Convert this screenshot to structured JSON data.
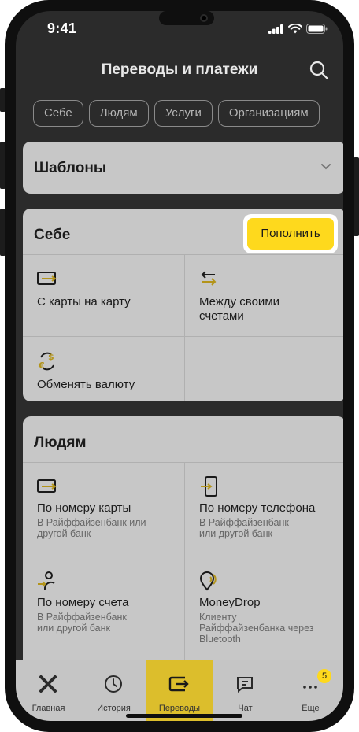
{
  "status": {
    "time": "9:41"
  },
  "header": {
    "title": "Переводы и платежи"
  },
  "chips": [
    "Себе",
    "Людям",
    "Услуги",
    "Организациям"
  ],
  "templates": {
    "title": "Шаблоны"
  },
  "self": {
    "title": "Себе",
    "topup_label": "Пополнить",
    "items": [
      {
        "label": "С карты на карту"
      },
      {
        "label": "Между своими\nсчетами"
      },
      {
        "label": "Обменять валюту"
      }
    ]
  },
  "people": {
    "title": "Людям",
    "items": [
      {
        "label": "По номеру карты",
        "sub": "В Райффайзенбанк или\nдругой банк"
      },
      {
        "label": "По номеру телефона",
        "sub": "В Райффайзенбанк\nили другой банк"
      },
      {
        "label": "По номеру счета",
        "sub": "В Райффайзенбанк\nили другой банк"
      },
      {
        "label": "MoneyDrop",
        "sub": "Клиенту\nРайффайзенбанка через\nBluetooth"
      }
    ]
  },
  "tabs": [
    {
      "label": "Главная",
      "icon": "home-x-icon"
    },
    {
      "label": "История",
      "icon": "clock-icon"
    },
    {
      "label": "Переводы",
      "icon": "transfer-icon",
      "active": true
    },
    {
      "label": "Чат",
      "icon": "chat-icon"
    },
    {
      "label": "Еще",
      "icon": "more-icon",
      "badge": "5"
    }
  ],
  "colors": {
    "accent": "#fed91d",
    "screen_bg": "#2b2b2b",
    "card_bg": "#c7c7c7",
    "icon_gold": "#b3941a"
  }
}
